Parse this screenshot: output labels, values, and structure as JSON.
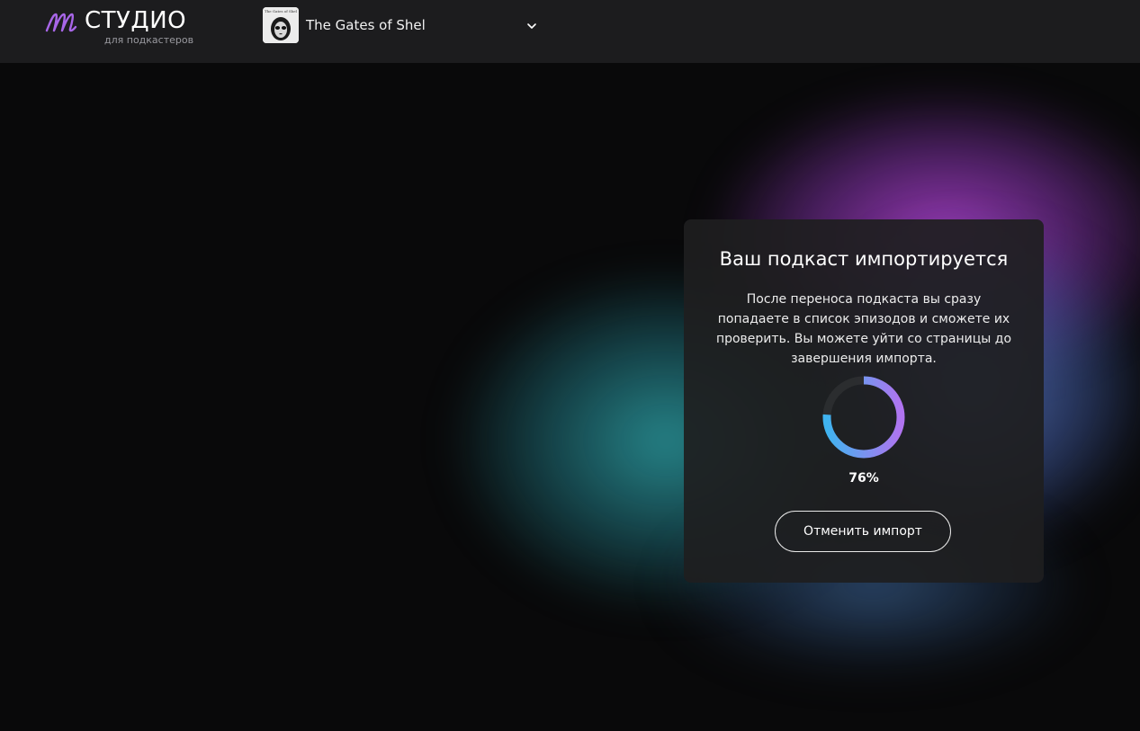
{
  "header": {
    "logo_title": "СТУДИО",
    "logo_subtitle": "для подкастеров",
    "podcast_name": "The Gates of Shel",
    "cover_caption": "The Gates of Shel"
  },
  "import_card": {
    "title": "Ваш подкаст импортируется",
    "description": "После переноса подкаста вы сразу попадаете в список эпизодов и сможете их проверить. Вы можете уйти со страницы до завершения импорта.",
    "progress_percent": 76,
    "progress_label": "76%",
    "cancel_label": "Отменить импорт"
  },
  "colors": {
    "brand_purple": "#a866e8",
    "progress_start": "#3fb4f0",
    "progress_end": "#b074f0",
    "header_bg": "#1c1c1e",
    "card_bg": "#1e1e20"
  },
  "icons": {
    "logo": "studio-logo-icon",
    "dropdown": "chevron-down-icon"
  }
}
